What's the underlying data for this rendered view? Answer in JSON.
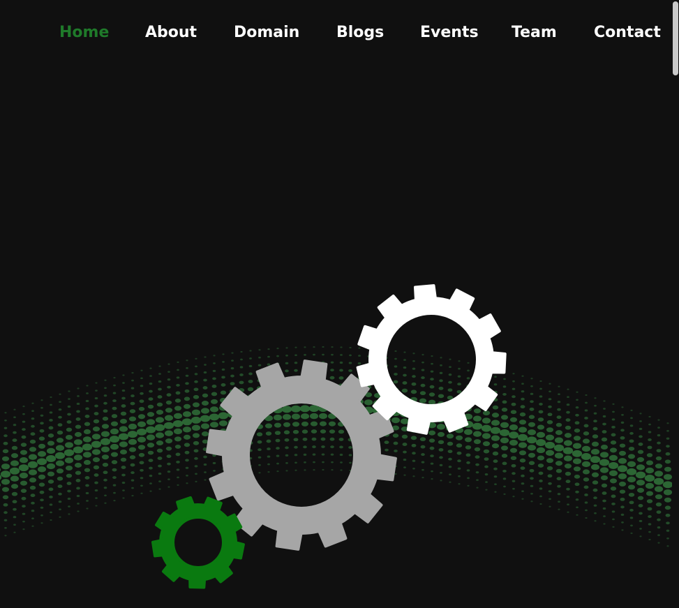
{
  "nav": {
    "items": [
      {
        "id": "home",
        "label": "Home",
        "active": true
      },
      {
        "id": "about",
        "label": "About",
        "active": false
      },
      {
        "id": "domain",
        "label": "Domain",
        "active": false
      },
      {
        "id": "blogs",
        "label": "Blogs",
        "active": false
      },
      {
        "id": "events",
        "label": "Events",
        "active": false
      },
      {
        "id": "team",
        "label": "Team",
        "active": false
      },
      {
        "id": "contact",
        "label": "Contact",
        "active": false
      }
    ]
  },
  "colors": {
    "background": "#101010",
    "nav_text": "#ffffff",
    "nav_active": "#1f7a2a",
    "gear_large": "#a6a6a6",
    "gear_white": "#ffffff",
    "gear_small": "#0a7a10",
    "dot_wave": "#2e6b37",
    "scrollbar_thumb": "#c9c9c9"
  },
  "hero": {
    "graphic_icons": [
      "gear-icon",
      "gear-icon",
      "gear-icon",
      "dot-wave-pattern"
    ]
  }
}
